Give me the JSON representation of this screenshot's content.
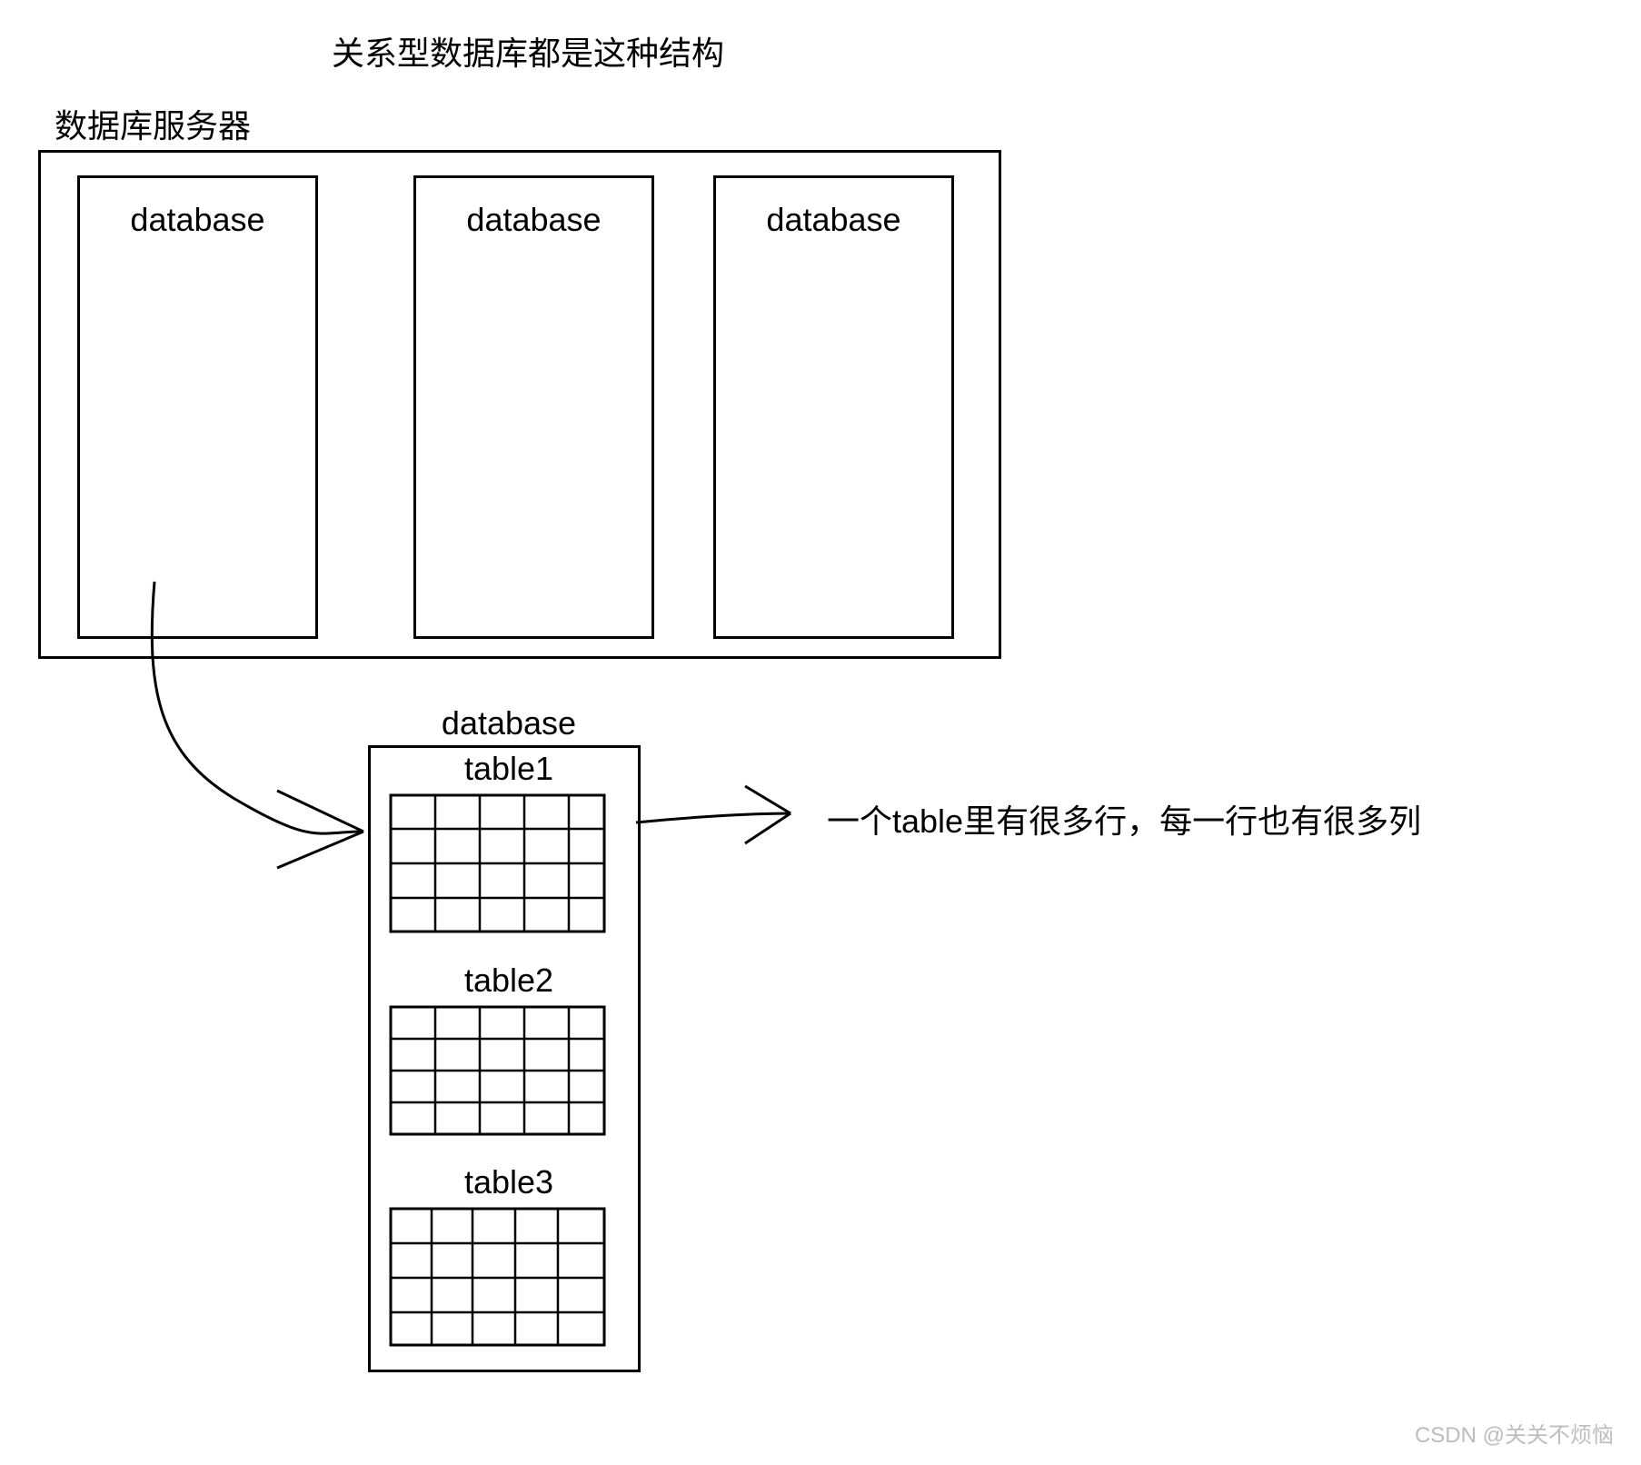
{
  "title": "关系型数据库都是这种结构",
  "server_label": "数据库服务器",
  "databases": {
    "db1": "database",
    "db2": "database",
    "db3": "database"
  },
  "detail": {
    "title": "database",
    "tables": {
      "t1": "table1",
      "t2": "table2",
      "t3": "table3"
    }
  },
  "table_note": "一个table里有很多行，每一行也有很多列",
  "watermark": "CSDN @关关不烦恼"
}
